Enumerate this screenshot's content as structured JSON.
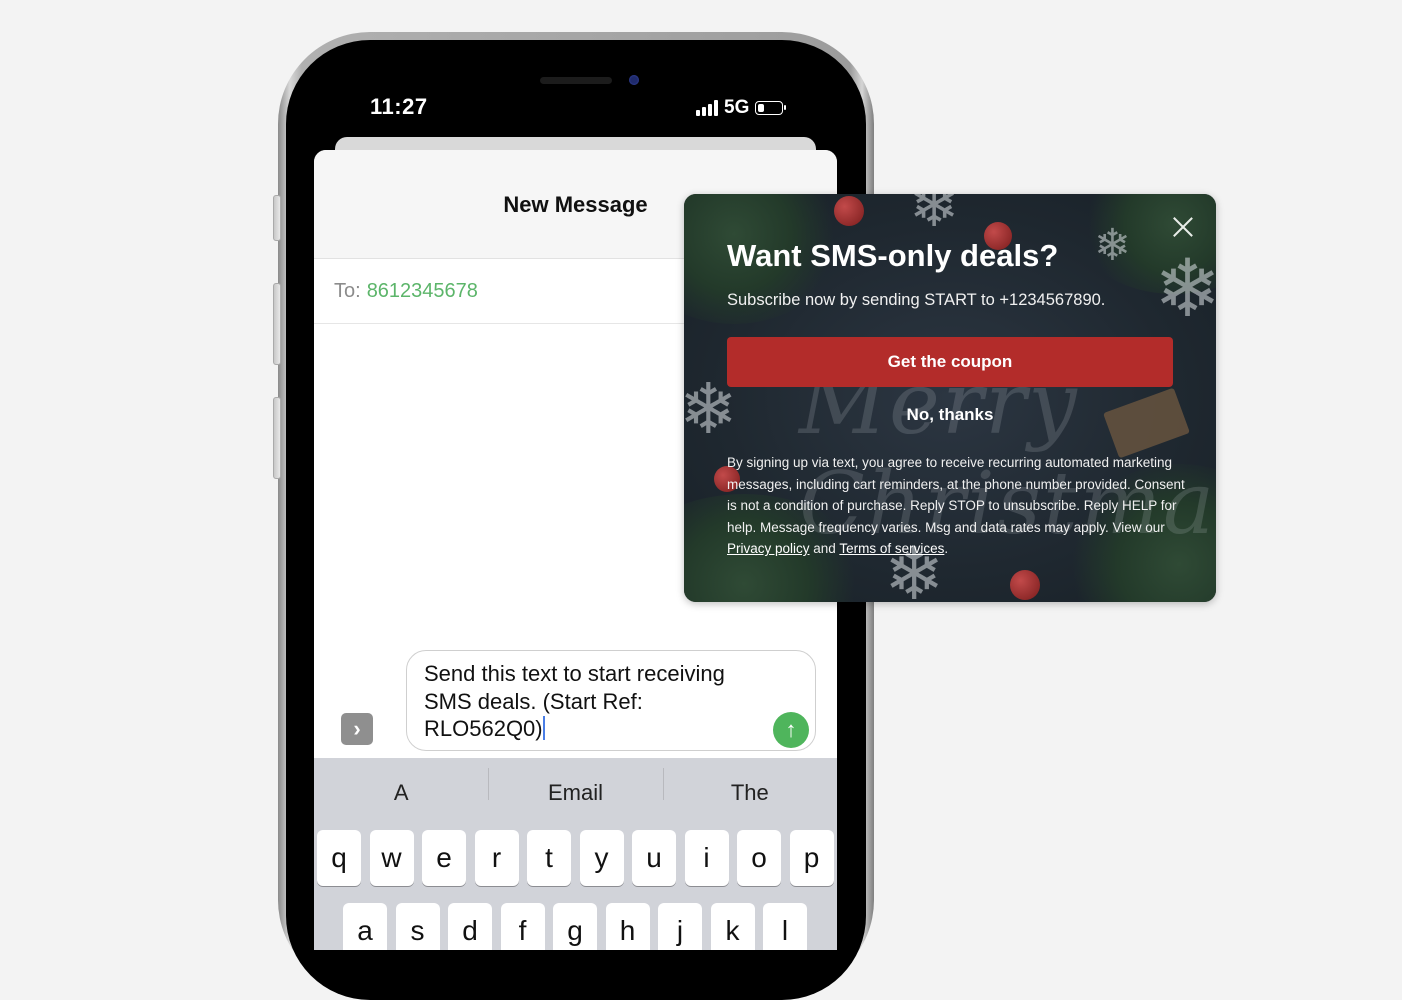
{
  "phone": {
    "status_bar": {
      "time": "11:27",
      "network": "5G",
      "signal_bars": 4,
      "battery_level_fraction": 0.25
    },
    "messages": {
      "nav_title": "New Message",
      "to_label": "To:",
      "to_value": "8612345678",
      "compose": {
        "text_line1": "Send this text to start receiving",
        "text_line2": "SMS deals. (Start Ref:",
        "text_line3": "RLO562Q0)",
        "apps_icon": "chevron-right-icon",
        "send_icon": "arrow-up-icon"
      }
    },
    "keyboard": {
      "suggestions": [
        "A",
        "Email",
        "The"
      ],
      "row1": [
        "q",
        "w",
        "e",
        "r",
        "t",
        "y",
        "u",
        "i",
        "o",
        "p"
      ],
      "row2": [
        "a",
        "s",
        "d",
        "f",
        "g",
        "h",
        "j",
        "k",
        "l"
      ]
    }
  },
  "popup": {
    "title": "Want SMS-only deals?",
    "subtitle": "Subscribe now by sending START to +1234567890.",
    "primary_button": "Get the coupon",
    "secondary_button": "No, thanks",
    "background_script_text": "Merry Christmas",
    "legal_text": "By signing up via text, you agree to receive recurring automated marketing messages, including cart reminders, at the phone number provided. Consent is not a condition of purchase. Reply STOP to unsubscribe. Reply HELP for help. Message frequency varies. Msg and data rates may apply. View our ",
    "privacy_link": "Privacy policy",
    "legal_and": " and ",
    "terms_link": "Terms of services",
    "legal_end": ".",
    "colors": {
      "button": "#b32c2a",
      "background": "#1f2830"
    }
  },
  "colors": {
    "recipient": "#5cb56a",
    "send_button": "#4fb55c"
  }
}
